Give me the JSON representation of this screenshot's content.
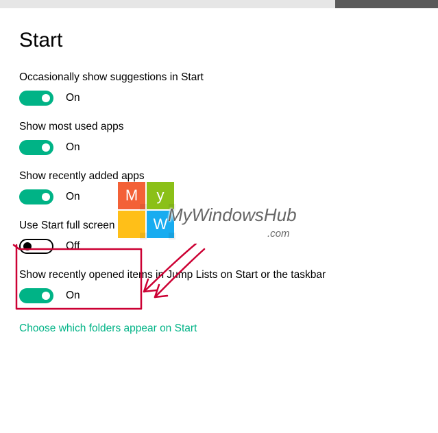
{
  "page_title": "Start",
  "settings": [
    {
      "label": "Occasionally show suggestions in Start",
      "state": "On",
      "on": true
    },
    {
      "label": "Show most used apps",
      "state": "On",
      "on": true
    },
    {
      "label": "Show recently added apps",
      "state": "On",
      "on": true
    },
    {
      "label": "Use Start full screen",
      "state": "Off",
      "on": false
    },
    {
      "label": "Show recently opened items in Jump Lists on Start or the taskbar",
      "state": "On",
      "on": true
    }
  ],
  "footer_link": "Choose which folders appear on Start",
  "watermark": {
    "text": "MyWindowsHub",
    "sub": ".com",
    "tiles": [
      "M",
      "y",
      "",
      "W"
    ]
  },
  "accent_color": "#00b386"
}
